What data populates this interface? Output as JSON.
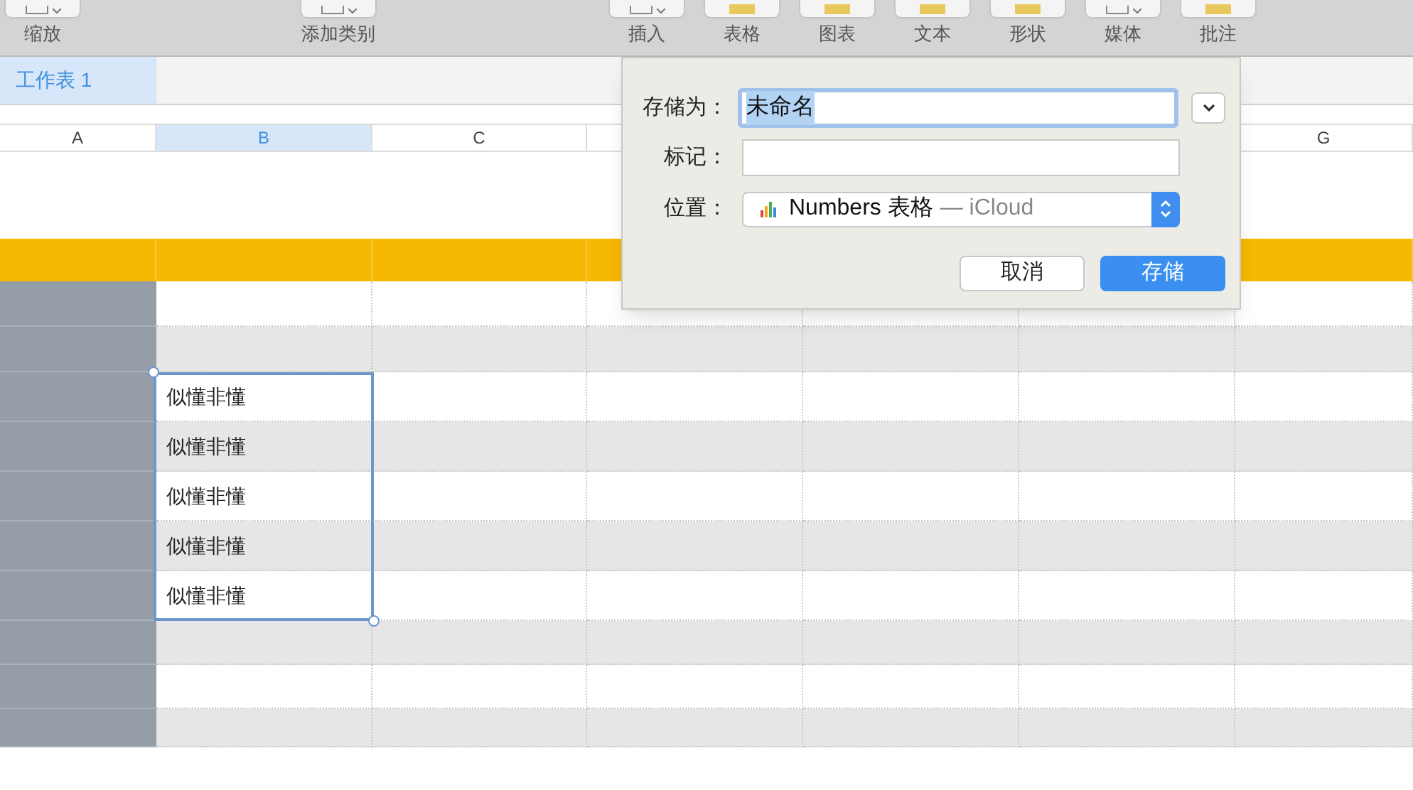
{
  "toolbar": [
    {
      "label": "缩放",
      "kind": "dropdown"
    },
    {
      "label": "添加类别",
      "kind": "dropdown"
    },
    {
      "label": "插入",
      "kind": "dropdown"
    },
    {
      "label": "表格",
      "kind": "plain"
    },
    {
      "label": "图表",
      "kind": "plain"
    },
    {
      "label": "文本",
      "kind": "plain"
    },
    {
      "label": "形状",
      "kind": "plain"
    },
    {
      "label": "媒体",
      "kind": "dropdown"
    },
    {
      "label": "批注",
      "kind": "plain"
    }
  ],
  "sheet_tabs": [
    {
      "label": "工作表 1",
      "selected": true
    }
  ],
  "column_headers": [
    {
      "label": "A",
      "selected": false
    },
    {
      "label": "B",
      "selected": true
    },
    {
      "label": "C",
      "selected": false
    },
    {
      "label": "G",
      "selected": false
    }
  ],
  "selected_cells": [
    "似懂非懂",
    "似懂非懂",
    "似懂非懂",
    "似懂非懂",
    "似懂非懂"
  ],
  "save_dialog": {
    "save_as_label": "存储为：",
    "save_as_value": "未命名",
    "value_selected": true,
    "tags_label": "标记：",
    "location_label": "位置：",
    "location_name": "Numbers 表格",
    "location_suffix": "— iCloud",
    "buttons": [
      {
        "label": "取消",
        "default": false
      },
      {
        "label": "存储",
        "default": true
      }
    ]
  }
}
